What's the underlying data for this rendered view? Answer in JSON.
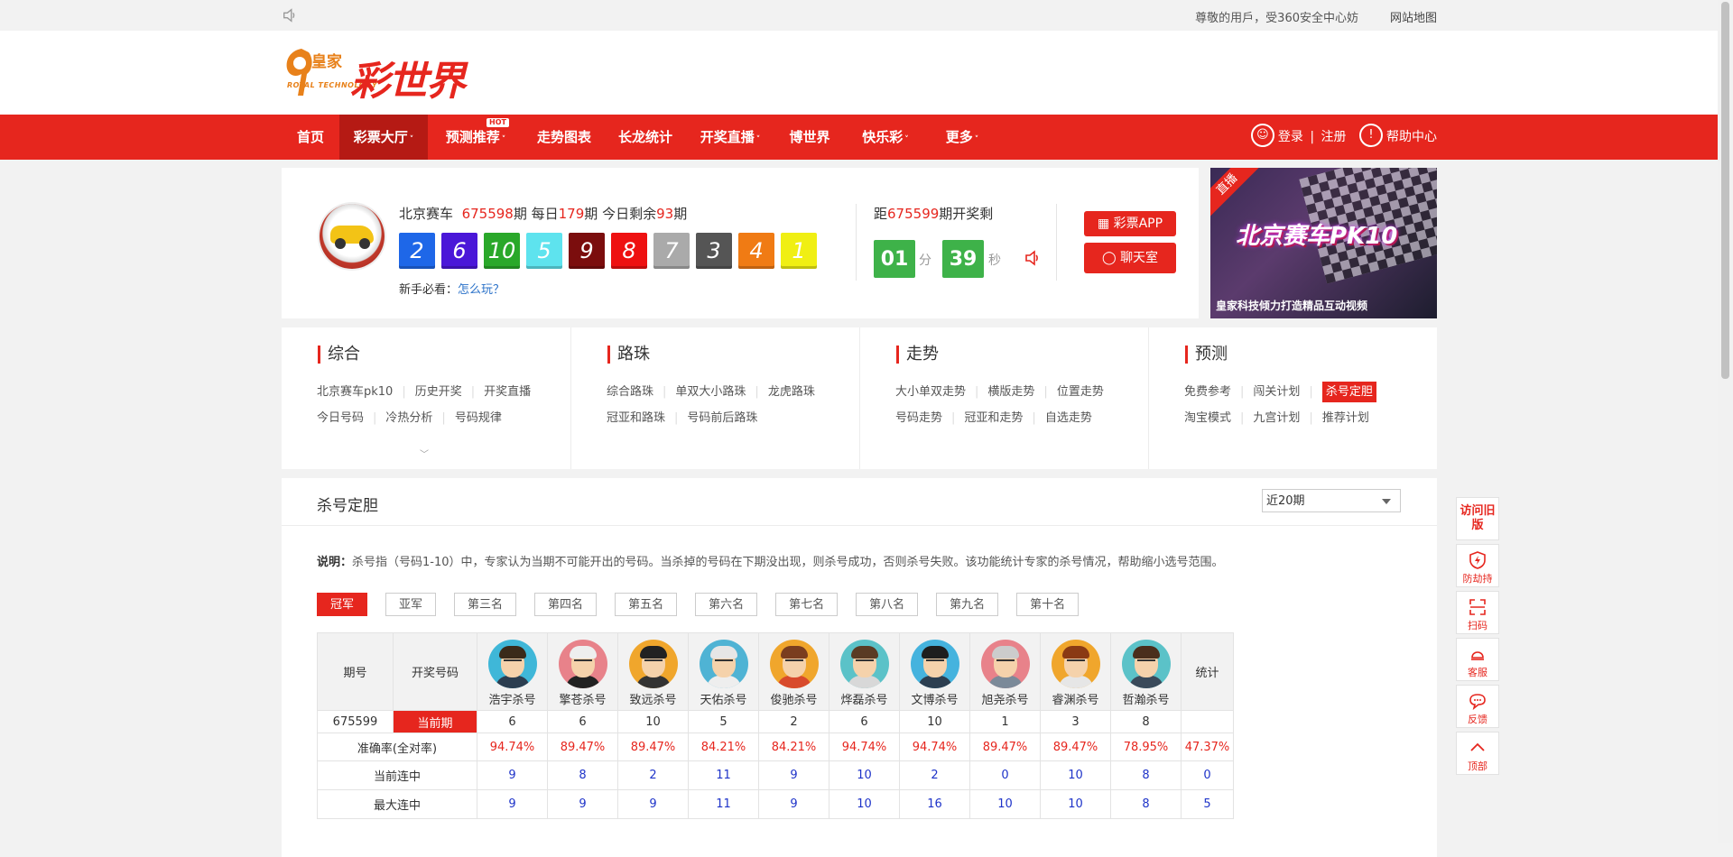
{
  "topbar": {
    "notice": "尊敬的用戶，受360安全中心妨",
    "sitemap": "网站地图"
  },
  "logo": {
    "brand": "皇家",
    "sub": "ROYAL TECHNOLOGY",
    "name": "彩世界"
  },
  "nav": {
    "items": [
      {
        "label": "首页"
      },
      {
        "label": "彩票大厅",
        "caret": "˅"
      },
      {
        "label": "预测推荐",
        "caret": "˅",
        "badge": "HOT"
      },
      {
        "label": "走势图表"
      },
      {
        "label": "长龙统计"
      },
      {
        "label": "开奖直播",
        "caret": "˅"
      },
      {
        "label": "博世界"
      },
      {
        "label": "快乐彩",
        "caret": "˅"
      },
      {
        "label": "更多",
        "caret": "˅"
      }
    ],
    "login": "登录",
    "sep": "|",
    "register": "注册",
    "help": "帮助中心"
  },
  "draw": {
    "game": "北京赛车",
    "period": "675598",
    "period_suffix": "期",
    "daily_prefix": "每日",
    "daily": "179",
    "daily_suffix": "期",
    "remain_prefix": "今日剩余",
    "remain": "93",
    "remain_suffix": "期",
    "balls": [
      {
        "n": "2",
        "color": "#1e67e8"
      },
      {
        "n": "6",
        "color": "#4a17d8"
      },
      {
        "n": "10",
        "color": "#2aa82a"
      },
      {
        "n": "5",
        "color": "#5ee3ee"
      },
      {
        "n": "9",
        "color": "#7b0d0d"
      },
      {
        "n": "8",
        "color": "#ee1111"
      },
      {
        "n": "7",
        "color": "#aaaaaa"
      },
      {
        "n": "3",
        "color": "#555555"
      },
      {
        "n": "4",
        "color": "#f07b14"
      },
      {
        "n": "1",
        "color": "#f0ef13"
      }
    ],
    "newbie_label": "新手必看：",
    "newbie_link": "怎么玩？",
    "countdown_prefix": "距",
    "next_period": "675599",
    "countdown_suffix": "期开奖剩",
    "minutes": "01",
    "minutes_unit": "分",
    "seconds": "39",
    "seconds_unit": "秒",
    "app_button": "彩票APP",
    "chat_button": "聊天室"
  },
  "ad": {
    "live": "直播",
    "title": "北京赛车PK10",
    "tagline": "皇家科技倾力打造精品互动视频"
  },
  "menu": [
    {
      "title": "综合",
      "rows": [
        [
          "北京赛车pk10",
          "历史开奖",
          "开奖直播"
        ],
        [
          "今日号码",
          "冷热分析",
          "号码规律"
        ]
      ]
    },
    {
      "title": "路珠",
      "rows": [
        [
          "综合路珠",
          "单双大小路珠",
          "龙虎路珠"
        ],
        [
          "冠亚和路珠",
          "号码前后路珠"
        ]
      ]
    },
    {
      "title": "走势",
      "rows": [
        [
          "大小单双走势",
          "横版走势",
          "位置走势"
        ],
        [
          "号码走势",
          "冠亚和走势",
          "自选走势"
        ]
      ]
    },
    {
      "title": "预测",
      "rows": [
        [
          "免费参考",
          "闯关计划",
          "杀号定胆"
        ],
        [
          "淘宝模式",
          "九宫计划",
          "推荐计划"
        ]
      ]
    }
  ],
  "card": {
    "title": "杀号定胆",
    "select": "近20期",
    "desc_label": "说明：",
    "desc": "杀号指（号码1-10）中，专家认为当期不可能开出的号码。当杀掉的号码在下期没出现，则杀号成功，否则杀号失败。该功能统计专家的杀号情况，帮助缩小选号范围。",
    "tabs": [
      "冠军",
      "亚军",
      "第三名",
      "第四名",
      "第五名",
      "第六名",
      "第七名",
      "第八名",
      "第九名",
      "第十名"
    ],
    "table": {
      "col_period": "期号",
      "col_draw": "开奖号码",
      "col_stats": "统计",
      "experts": [
        {
          "name": "浩宇杀号",
          "bg": "#3fb7d8",
          "hair": "#3a2a1a",
          "body": "#2c3e50"
        },
        {
          "name": "擎苍杀号",
          "bg": "#e8828a",
          "hair": "#eeeeee",
          "body": "#222222"
        },
        {
          "name": "致远杀号",
          "bg": "#f0a62c",
          "hair": "#222222",
          "body": "#333333"
        },
        {
          "name": "天佑杀号",
          "bg": "#4fb3d4",
          "hair": "#e6e6e6",
          "body": "#eeeeee"
        },
        {
          "name": "俊驰杀号",
          "bg": "#f0a62c",
          "hair": "#7a3d1f",
          "body": "#d84a2c"
        },
        {
          "name": "烨磊杀号",
          "bg": "#5bc2c8",
          "hair": "#5a3b24",
          "body": "#d8d8d8"
        },
        {
          "name": "文博杀号",
          "bg": "#45b3de",
          "hair": "#1e1e1e",
          "body": "#2c3e50"
        },
        {
          "name": "旭尧杀号",
          "bg": "#e8828a",
          "hair": "#cccccc",
          "body": "#7b8a99"
        },
        {
          "name": "睿渊杀号",
          "bg": "#f0a62c",
          "hair": "#8a3a14",
          "body": "#e6e6e6"
        },
        {
          "name": "哲瀚杀号",
          "bg": "#5bc2c8",
          "hair": "#4a2e1c",
          "body": "#3a4a5a"
        }
      ],
      "current": {
        "period": "675599",
        "label": "当前期",
        "values": [
          "6",
          "6",
          "10",
          "5",
          "2",
          "6",
          "10",
          "1",
          "3",
          "8"
        ],
        "stat": ""
      },
      "rows": [
        {
          "label": "准确率(全对率)",
          "kind": "pct",
          "values": [
            "94.74%",
            "89.47%",
            "89.47%",
            "84.21%",
            "84.21%",
            "94.74%",
            "94.74%",
            "89.47%",
            "89.47%",
            "78.95%"
          ],
          "stat": "47.37%"
        },
        {
          "label": "当前连中",
          "kind": "blue",
          "values": [
            "9",
            "8",
            "2",
            "11",
            "9",
            "10",
            "2",
            "0",
            "10",
            "8"
          ],
          "stat": "0"
        },
        {
          "label": "最大连中",
          "kind": "blue",
          "values": [
            "9",
            "9",
            "9",
            "11",
            "9",
            "10",
            "16",
            "10",
            "10",
            "8"
          ],
          "stat": "5"
        }
      ]
    }
  },
  "float": {
    "old": "访问旧版",
    "items": [
      {
        "label": "防劫持",
        "icon": "shield-icon"
      },
      {
        "label": "扫码",
        "icon": "scan-icon"
      },
      {
        "label": "客服",
        "icon": "support-icon"
      },
      {
        "label": "反馈",
        "icon": "chat-icon"
      },
      {
        "label": "顶部",
        "icon": "up-icon"
      }
    ]
  }
}
